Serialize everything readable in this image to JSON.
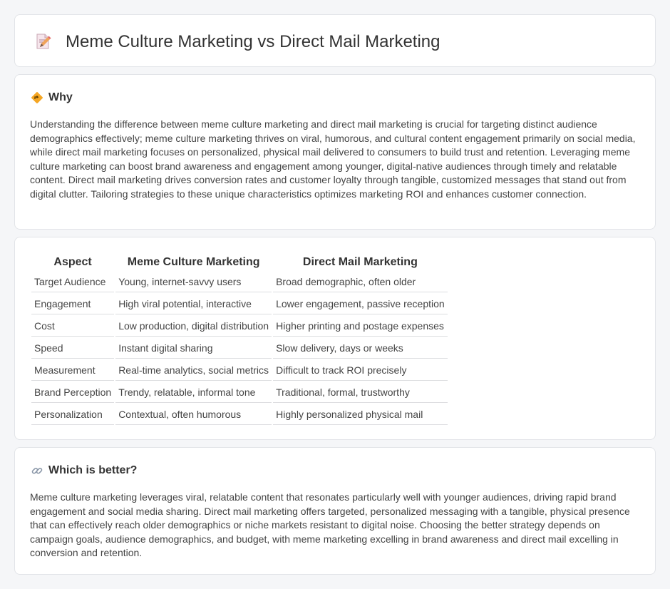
{
  "header": {
    "title": "Meme Culture Marketing vs Direct Mail Marketing",
    "icon": "document-pencil-icon"
  },
  "why": {
    "icon": "diamond-direction-icon",
    "heading": "Why",
    "text": "Understanding the difference between meme culture marketing and direct mail marketing is crucial for targeting distinct audience demographics effectively; meme culture marketing thrives on viral, humorous, and cultural content engagement primarily on social media, while direct mail marketing focuses on personalized, physical mail delivered to consumers to build trust and retention. Leveraging meme culture marketing can boost brand awareness and engagement among younger, digital-native audiences through timely and relatable content. Direct mail marketing drives conversion rates and customer loyalty through tangible, customized messages that stand out from digital clutter. Tailoring strategies to these unique characteristics optimizes marketing ROI and enhances customer connection."
  },
  "comparison": {
    "headers": [
      "Aspect",
      "Meme Culture Marketing",
      "Direct Mail Marketing"
    ],
    "rows": [
      [
        "Target Audience",
        "Young, internet-savvy users",
        "Broad demographic, often older"
      ],
      [
        "Engagement",
        "High viral potential, interactive",
        "Lower engagement, passive reception"
      ],
      [
        "Cost",
        "Low production, digital distribution",
        "Higher printing and postage expenses"
      ],
      [
        "Speed",
        "Instant digital sharing",
        "Slow delivery, days or weeks"
      ],
      [
        "Measurement",
        "Real-time analytics, social metrics",
        "Difficult to track ROI precisely"
      ],
      [
        "Brand Perception",
        "Trendy, relatable, informal tone",
        "Traditional, formal, trustworthy"
      ],
      [
        "Personalization",
        "Contextual, often humorous",
        "Highly personalized physical mail"
      ]
    ]
  },
  "better": {
    "icon": "link-icon",
    "heading": "Which is better?",
    "text": "Meme culture marketing leverages viral, relatable content that resonates particularly well with younger audiences, driving rapid brand engagement and social media sharing. Direct mail marketing offers targeted, personalized messaging with a tangible, physical presence that can effectively reach older demographics or niche markets resistant to digital noise. Choosing the better strategy depends on campaign goals, audience demographics, and budget, with meme marketing excelling in brand awareness and direct mail excelling in conversion and retention."
  }
}
